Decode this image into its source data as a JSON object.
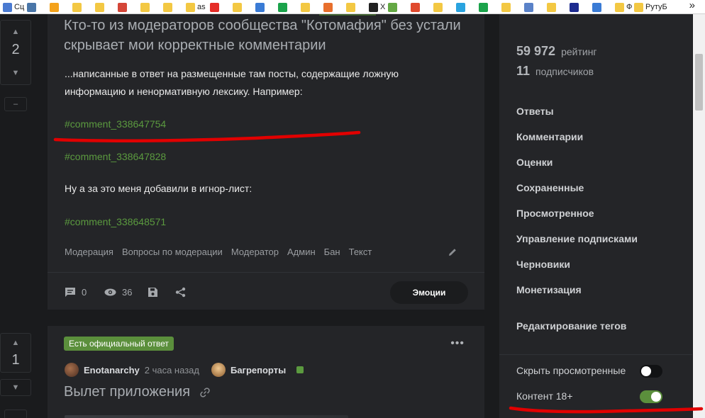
{
  "bookmarks": {
    "items": [
      {
        "label": "Сц",
        "color": "#4a7ad1"
      },
      {
        "label": "",
        "color": "#4a76a8"
      },
      {
        "label": "",
        "color": "#f4a21b"
      },
      {
        "label": "",
        "color": "#f3c843"
      },
      {
        "label": "",
        "color": "#f3c843"
      },
      {
        "label": "",
        "color": "#d44638"
      },
      {
        "label": "",
        "color": "#f3c843"
      },
      {
        "label": "",
        "color": "#f3c843"
      },
      {
        "label": "as",
        "color": "#f3c843"
      },
      {
        "label": "",
        "color": "#e52d27"
      },
      {
        "label": "",
        "color": "#f3c843"
      },
      {
        "label": "",
        "color": "#3a7bd5"
      },
      {
        "label": "",
        "color": "#1ba34b"
      },
      {
        "label": "",
        "color": "#f3c843"
      },
      {
        "label": "",
        "color": "#e86f2c"
      },
      {
        "label": "",
        "color": "#f3c843"
      },
      {
        "label": "X",
        "color": "#222222"
      },
      {
        "label": "",
        "color": "#64a844"
      },
      {
        "label": "",
        "color": "#e04a2e"
      },
      {
        "label": "",
        "color": "#f3c843"
      },
      {
        "label": "",
        "color": "#2aa3df"
      },
      {
        "label": "",
        "color": "#1ba34b"
      },
      {
        "label": "",
        "color": "#f3c843"
      },
      {
        "label": "",
        "color": "#5a82c8"
      },
      {
        "label": "",
        "color": "#f3c843"
      },
      {
        "label": "",
        "color": "#1d2b8f"
      },
      {
        "label": "",
        "color": "#3a7bd5"
      },
      {
        "label": "Ф",
        "color": "#f3c843"
      },
      {
        "label": "РутуБ",
        "color": "#f3c843"
      }
    ],
    "more": "»"
  },
  "post1": {
    "votes": "2",
    "title": "Кто-то из модераторов сообщества \"Котомафия\" без устали скрывает мои корректные комментарии",
    "text1": "...написанные в ответ на размещенные там посты, содержащие ложную информацию и ненормативную лексику. Например:",
    "link1": "#comment_338647754",
    "link2": "#comment_338647828",
    "text2": "Ну а за это меня добавили в игнор-лист:",
    "link3": "#comment_338648571",
    "tags": [
      "Модерация",
      "Вопросы по модерации",
      "Модератор",
      "Админ",
      "Бан",
      "Текст"
    ],
    "comments": "0",
    "views": "36",
    "emotions_label": "Эмоции",
    "minus_label": "–"
  },
  "post2": {
    "votes": "1",
    "badge": "Есть официальный ответ",
    "author": "Enotanarchy",
    "time": "2 часа назад",
    "community": "Багрепорты",
    "title": "Вылет приложения"
  },
  "sidebar": {
    "rating_value": "59 972",
    "rating_label": "рейтинг",
    "subs_value": "11",
    "subs_label": "подписчиков",
    "menu": [
      "Ответы",
      "Комментарии",
      "Оценки",
      "Сохраненные",
      "Просмотренное",
      "Управление подписками",
      "Черновики",
      "Монетизация"
    ],
    "edit_tags": "Редактирование тегов",
    "hide_viewed_label": "Скрыть просмотренные",
    "hide_viewed_on": false,
    "adult_label": "Контент 18+",
    "adult_on": true,
    "toggle_on_color": "#5b8f3c",
    "toggle_off_color": "#111214"
  },
  "colors": {
    "annotation": "#e10000",
    "link": "#5b9a3f"
  }
}
